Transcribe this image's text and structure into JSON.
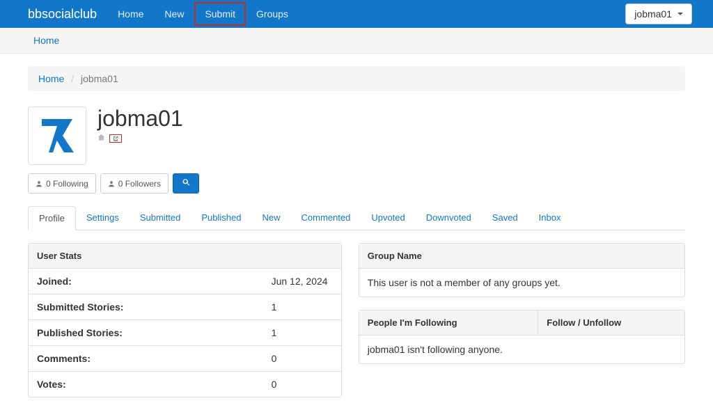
{
  "brand": "bbsocialclub",
  "nav": {
    "home": "Home",
    "new": "New",
    "submit": "Submit",
    "groups": "Groups"
  },
  "user_dropdown": "jobma01",
  "subhead_link": "Home",
  "breadcrumb": {
    "home": "Home",
    "current": "jobma01"
  },
  "profile": {
    "username": "jobma01",
    "following_btn": "0 Following",
    "followers_btn": "0 Followers"
  },
  "tabs": {
    "profile": "Profile",
    "settings": "Settings",
    "submitted": "Submitted",
    "published": "Published",
    "new": "New",
    "commented": "Commented",
    "upvoted": "Upvoted",
    "downvoted": "Downvoted",
    "saved": "Saved",
    "inbox": "Inbox"
  },
  "stats": {
    "heading": "User Stats",
    "joined_label": "Joined:",
    "joined_value": "Jun 12, 2024",
    "submitted_label": "Submitted Stories:",
    "submitted_value": "1",
    "published_label": "Published Stories:",
    "published_value": "1",
    "comments_label": "Comments:",
    "comments_value": "0",
    "votes_label": "Votes:",
    "votes_value": "0"
  },
  "groups_panel": {
    "heading": "Group Name",
    "body": "This user is not a member of any groups yet."
  },
  "following_panel": {
    "col1": "People I'm Following",
    "col2": "Follow / Unfollow",
    "body": "jobma01 isn't following anyone."
  }
}
